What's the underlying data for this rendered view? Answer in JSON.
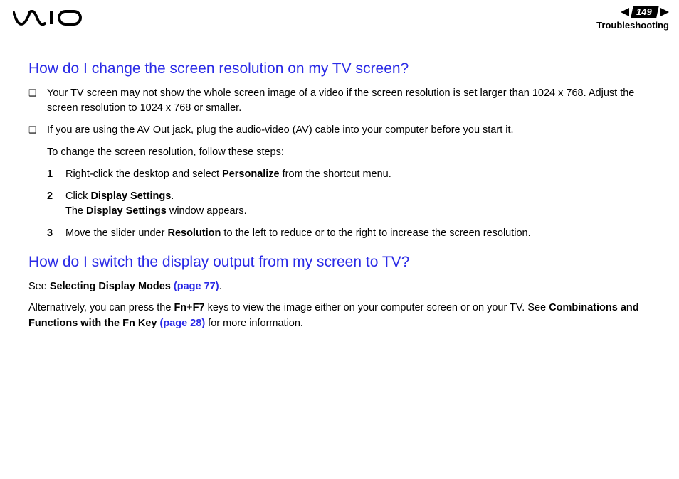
{
  "header": {
    "page_number": "149",
    "section": "Troubleshooting"
  },
  "q1": {
    "title": "How do I change the screen resolution on my TV screen?",
    "bullet1": "Your TV screen may not show the whole screen image of a video if the screen resolution is set larger than 1024 x 768. Adjust the screen resolution to 1024 x 768 or smaller.",
    "bullet2": "If you are using the AV Out jack, plug the audio-video (AV) cable into your computer before you start it.",
    "intro_steps": "To change the screen resolution, follow these steps:",
    "step1_pre": "Right-click the desktop and select ",
    "step1_bold": "Personalize",
    "step1_post": " from the shortcut menu.",
    "step2_pre": "Click ",
    "step2_bold1": "Display Settings",
    "step2_mid": ".",
    "step2_line2_pre": "The ",
    "step2_line2_bold": "Display Settings",
    "step2_line2_post": " window appears.",
    "step3_pre": "Move the slider under ",
    "step3_bold": "Resolution",
    "step3_post": " to the left to reduce or to the right to increase the screen resolution."
  },
  "q2": {
    "title": "How do I switch the display output from my screen to TV?",
    "p1_pre": "See ",
    "p1_bold": "Selecting Display Modes ",
    "p1_link": "(page 77)",
    "p1_post": ".",
    "p2_pre": "Alternatively, you can press the ",
    "p2_bold1": "Fn",
    "p2_plus": "+",
    "p2_bold2": "F7",
    "p2_mid": " keys to view the image either on your computer screen or on your TV. See ",
    "p2_bold3": "Combinations and Functions with the Fn Key ",
    "p2_link": "(page 28)",
    "p2_post": " for more information."
  }
}
